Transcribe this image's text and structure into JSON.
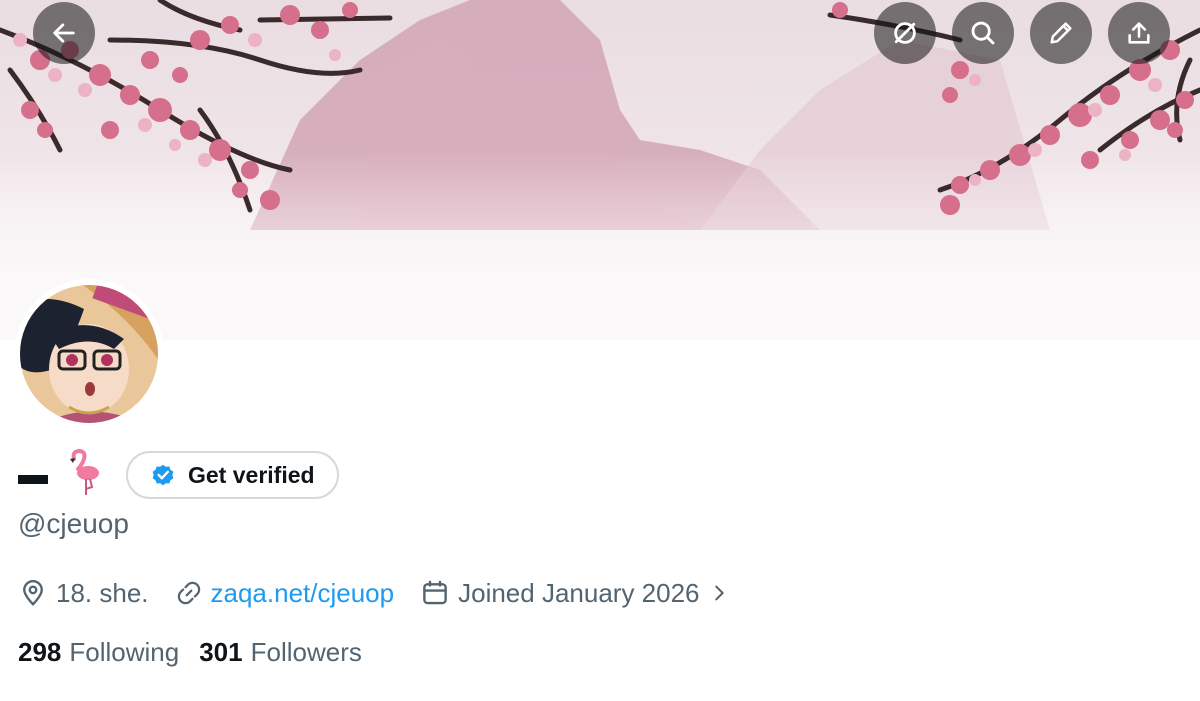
{
  "header": {
    "back_icon": "arrow-left-icon",
    "actions": [
      {
        "icon": "circle-slash-icon"
      },
      {
        "icon": "search-icon"
      },
      {
        "icon": "pencil-icon"
      },
      {
        "icon": "share-upload-icon"
      }
    ]
  },
  "profile": {
    "display_name": "▬",
    "name_emoji": "flamingo-icon",
    "verify_label": "Get verified",
    "handle": "@cjeuop",
    "location": "18. she.",
    "website": "zaqa.net/cjeuop",
    "joined": "Joined January 2026",
    "following_count": "298",
    "following_label": "Following",
    "followers_count": "301",
    "followers_label": "Followers"
  },
  "colors": {
    "link": "#1d9bf0",
    "secondary_text": "#536471",
    "verified_badge": "#1d9bf0"
  }
}
